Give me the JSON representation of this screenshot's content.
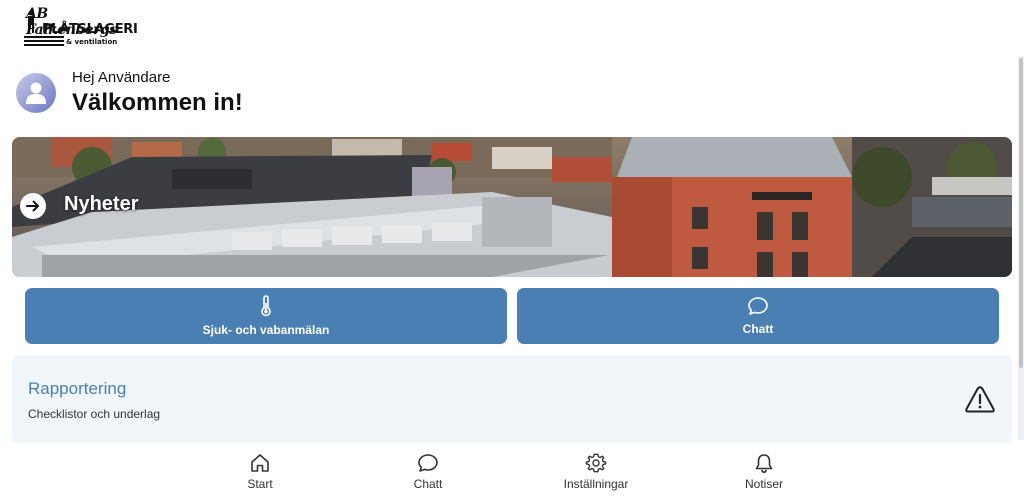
{
  "logo": {
    "line1": "AB Falkenbergs",
    "line2": "PLÅTSLAGERI",
    "line3": "& ventilation"
  },
  "greeting": {
    "small": "Hej Användare",
    "big": "Välkommen in!"
  },
  "news": {
    "title": "Nyheter",
    "icon": "arrow-right-icon"
  },
  "actions": {
    "sick_label": "Sjuk- och vabanmälan",
    "sick_icon": "thermometer-icon",
    "chat_label": "Chatt",
    "chat_icon": "chat-bubble-icon"
  },
  "report": {
    "title": "Rapportering",
    "subtitle": "Checklistor och underlag",
    "icon": "warning-triangle-icon"
  },
  "nav": {
    "items": [
      {
        "label": "Start",
        "icon": "home-icon"
      },
      {
        "label": "Chatt",
        "icon": "chat-bubble-icon"
      },
      {
        "label": "Inställningar",
        "icon": "gear-icon"
      },
      {
        "label": "Notiser",
        "icon": "bell-icon"
      }
    ]
  },
  "colors": {
    "accent": "#4a7fb3",
    "card_bg": "#f1f6fb",
    "avatar_gradient": [
      "#c6cbe9",
      "#6d77c2"
    ]
  }
}
